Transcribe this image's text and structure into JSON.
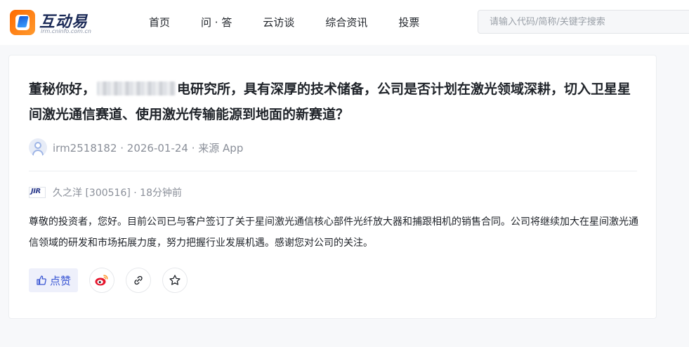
{
  "header": {
    "logo_title": "互动易",
    "logo_subtitle": "irm.cninfo.com.cn",
    "nav": [
      {
        "label": "首页"
      },
      {
        "label": "问 · 答"
      },
      {
        "label": "云访谈"
      },
      {
        "label": "综合资讯"
      },
      {
        "label": "投票"
      }
    ],
    "search": {
      "placeholder": "请输入代码/简称/关键字搜索",
      "value": ""
    }
  },
  "post": {
    "question_before_blur": "董秘你好，",
    "question_after_blur": "电研究所，具有深厚的技术储备，公司是否计划在激光领域深耕，切入卫星星间激光通信赛道、使用激光传输能源到地面的新赛道？",
    "asker_meta": "irm2518182 · 2026-01-24 · 来源 App",
    "company_logo_text": "JIR",
    "company_meta": "久之洋 [300516] · 18分钟前",
    "answer": "尊敬的投资者，您好。目前公司已与客户签订了关于星间激光通信核心部件光纤放大器和捕跟相机的销售合同。公司将继续加大在星间激光通信领域的研发和市场拓展力度，努力把握行业发展机遇。感谢您对公司的关注。",
    "like_label": "点赞"
  },
  "colors": {
    "accent": "#3b57d4",
    "like_bg": "#eef0fb",
    "weibo_red": "#e6162d",
    "weibo_orange": "#ff9933"
  }
}
